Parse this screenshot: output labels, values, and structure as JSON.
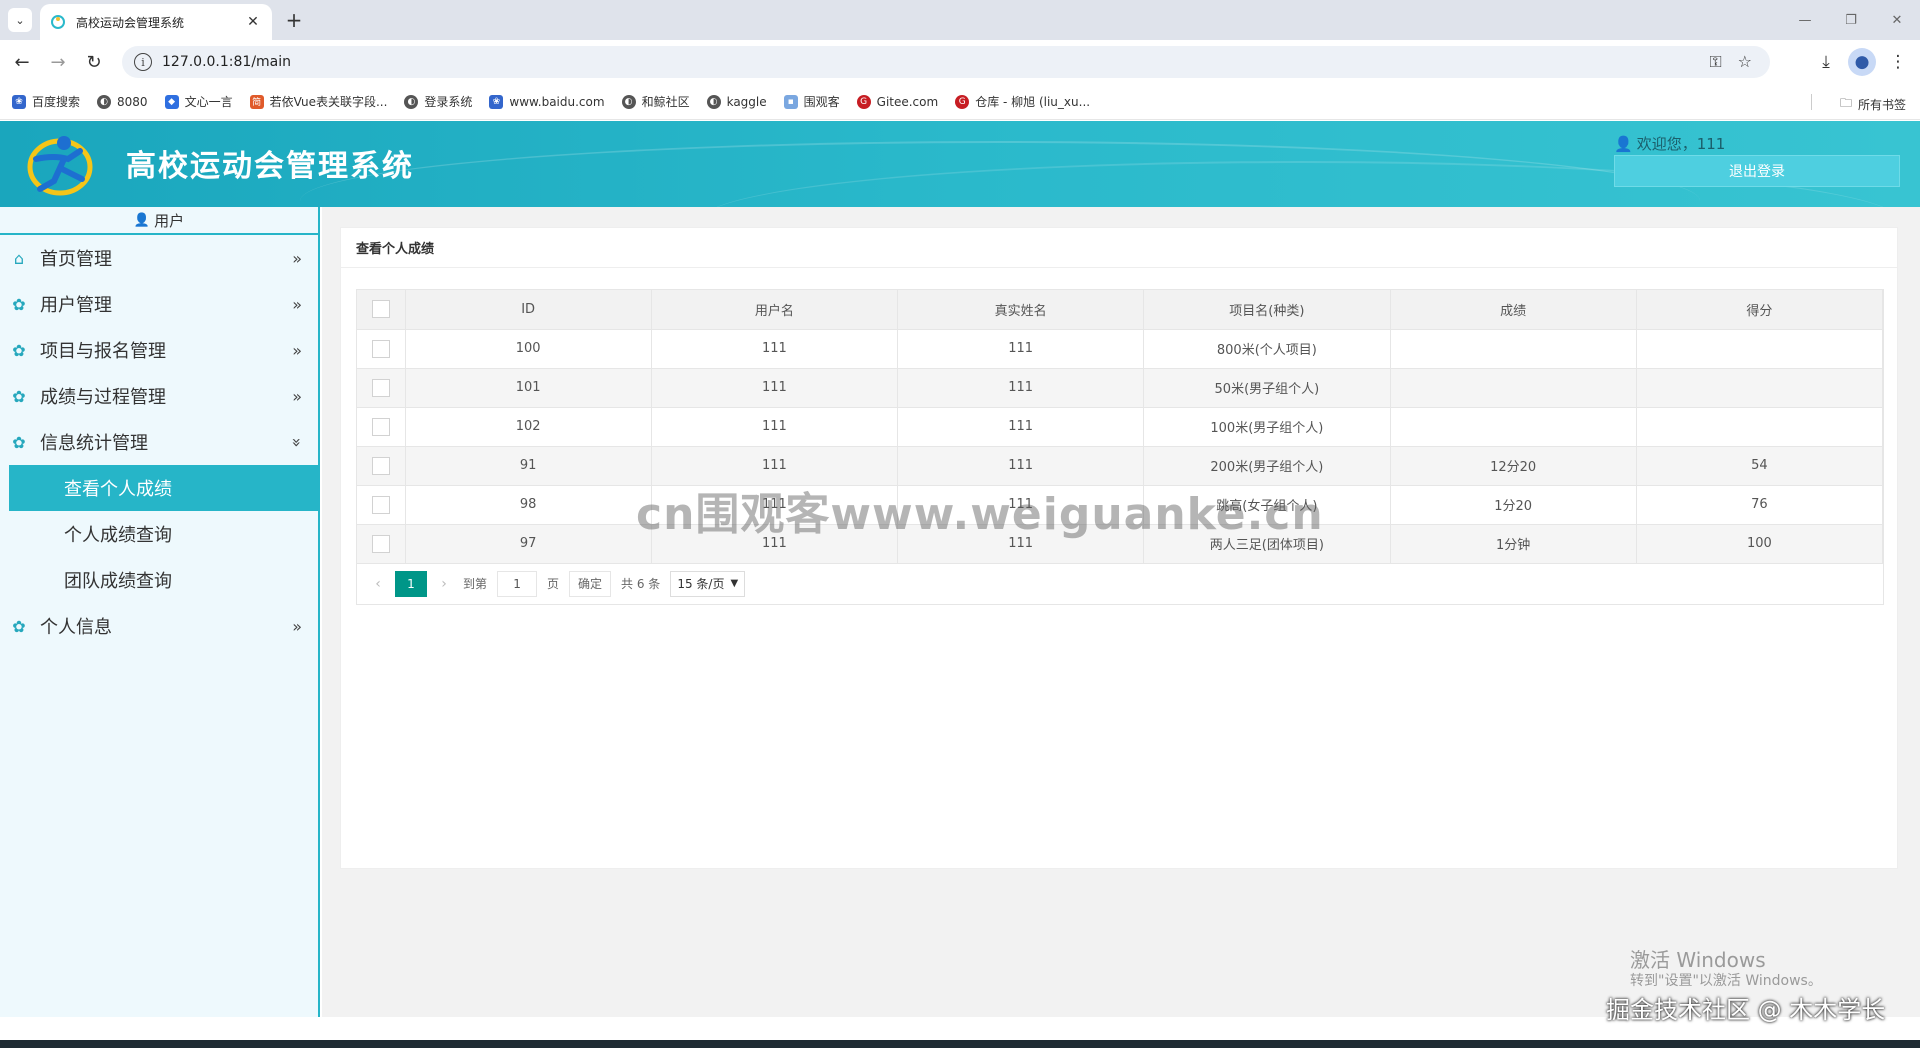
{
  "browser": {
    "tab_title": "高校运动会管理系统",
    "url": "127.0.0.1:81/main",
    "bookmarks": [
      "百度搜索",
      "8080",
      "文心一言",
      "若依Vue表关联字段...",
      "登录系统",
      "www.baidu.com",
      "和鲸社区",
      "kaggle",
      "围观客",
      "Gitee.com",
      "仓库 - 柳旭 (liu_xu..."
    ],
    "all_bookmarks": "所有书签"
  },
  "header": {
    "title": "高校运动会管理系统",
    "welcome": "欢迎您，111",
    "logout": "退出登录"
  },
  "sidebar": {
    "heading": "用户",
    "menu": [
      {
        "label": "首页管理",
        "icon": "home-icon"
      },
      {
        "label": "用户管理",
        "icon": "gear-icon"
      },
      {
        "label": "项目与报名管理",
        "icon": "gear-icon"
      },
      {
        "label": "成绩与过程管理",
        "icon": "gear-icon"
      },
      {
        "label": "信息统计管理",
        "icon": "gear-icon"
      },
      {
        "label": "个人信息",
        "icon": "gear-icon"
      }
    ],
    "submenu": [
      "查看个人成绩",
      "个人成绩查询",
      "团队成绩查询"
    ]
  },
  "main": {
    "panel_title": "查看个人成绩",
    "columns": [
      "ID",
      "用户名",
      "真实姓名",
      "项目名(种类)",
      "成绩",
      "得分"
    ],
    "rows": [
      [
        "100",
        "111",
        "111",
        "800米(个人项目)",
        "",
        ""
      ],
      [
        "101",
        "111",
        "111",
        "50米(男子组个人)",
        "",
        ""
      ],
      [
        "102",
        "111",
        "111",
        "100米(男子组个人)",
        "",
        ""
      ],
      [
        "91",
        "111",
        "111",
        "200米(男子组个人)",
        "12分20",
        "54"
      ],
      [
        "98",
        "111",
        "111",
        "跳高(女子组个人)",
        "1分20",
        "76"
      ],
      [
        "97",
        "111",
        "111",
        "两人三足(团体项目)",
        "1分钟",
        "100"
      ]
    ],
    "pager": {
      "current": "1",
      "goto_label": "到第",
      "goto_value": "1",
      "page_label": "页",
      "confirm": "确定",
      "total": "共 6 条",
      "page_size": "15 条/页"
    }
  },
  "overlay": {
    "watermark": "cn围观客www.weiguanke.cn",
    "activate_title": "激活 Windows",
    "activate_sub": "转到\"设置\"以激活 Windows。",
    "juejin": "掘金技术社区 @ 木木学长"
  },
  "colors": {
    "accent": "#26b5c8",
    "pager_active": "#009688",
    "sidebar_bg": "#eef9fd"
  }
}
